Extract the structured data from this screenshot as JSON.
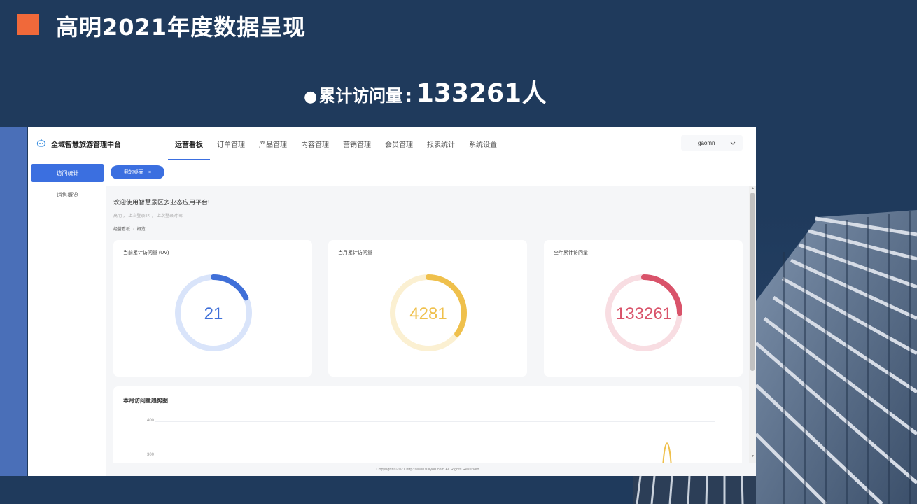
{
  "slide": {
    "title": "高明2021年度数据呈现",
    "stat_bullet": "●",
    "stat_label": "累计访问量",
    "stat_colon": ":",
    "stat_value": "133261人",
    "accent_color": "#f0693a",
    "background_color": "#1f3a5c"
  },
  "app": {
    "name": "全域智慧旅游管理中台",
    "logo_icon": "robot-icon",
    "nav": [
      "运营看板",
      "订单管理",
      "产品管理",
      "内容管理",
      "营销管理",
      "会员管理",
      "报表统计",
      "系统设置"
    ],
    "active_nav": "运营看板",
    "user": "gaomn",
    "user_chevron": "chevron-down-icon",
    "sidebar": [
      "访问统计",
      "销售概览"
    ],
    "active_sidebar": "访问统计",
    "tab_label": "我的桌面",
    "tab_close": "×",
    "welcome": "欢迎使用智慧景区多业态应用平台!",
    "meta": "高明 ， 上次登录IP: ， 上次登录时间:",
    "breadcrumb": [
      "经营看板",
      "概览"
    ],
    "breadcrumb_sep": "/",
    "primary_color": "#3b6fe0",
    "cards": [
      {
        "title": "当前累计访问量 (UV)",
        "value": "21",
        "color": "#3f6fd8",
        "ring_fraction": 0.18
      },
      {
        "title": "当月累计访问量",
        "value": "4281",
        "color": "#efc04c",
        "ring_fraction": 0.35
      },
      {
        "title": "全年累计访问量",
        "value": "133261",
        "color": "#d9536a",
        "ring_fraction": 0.25
      }
    ],
    "trend": {
      "title": "本月访问量趋势图",
      "y_ticks": [
        "400",
        "300"
      ]
    },
    "footer": "Copyright ©2021 http://www.tullyou.com All Rights Reserved"
  }
}
